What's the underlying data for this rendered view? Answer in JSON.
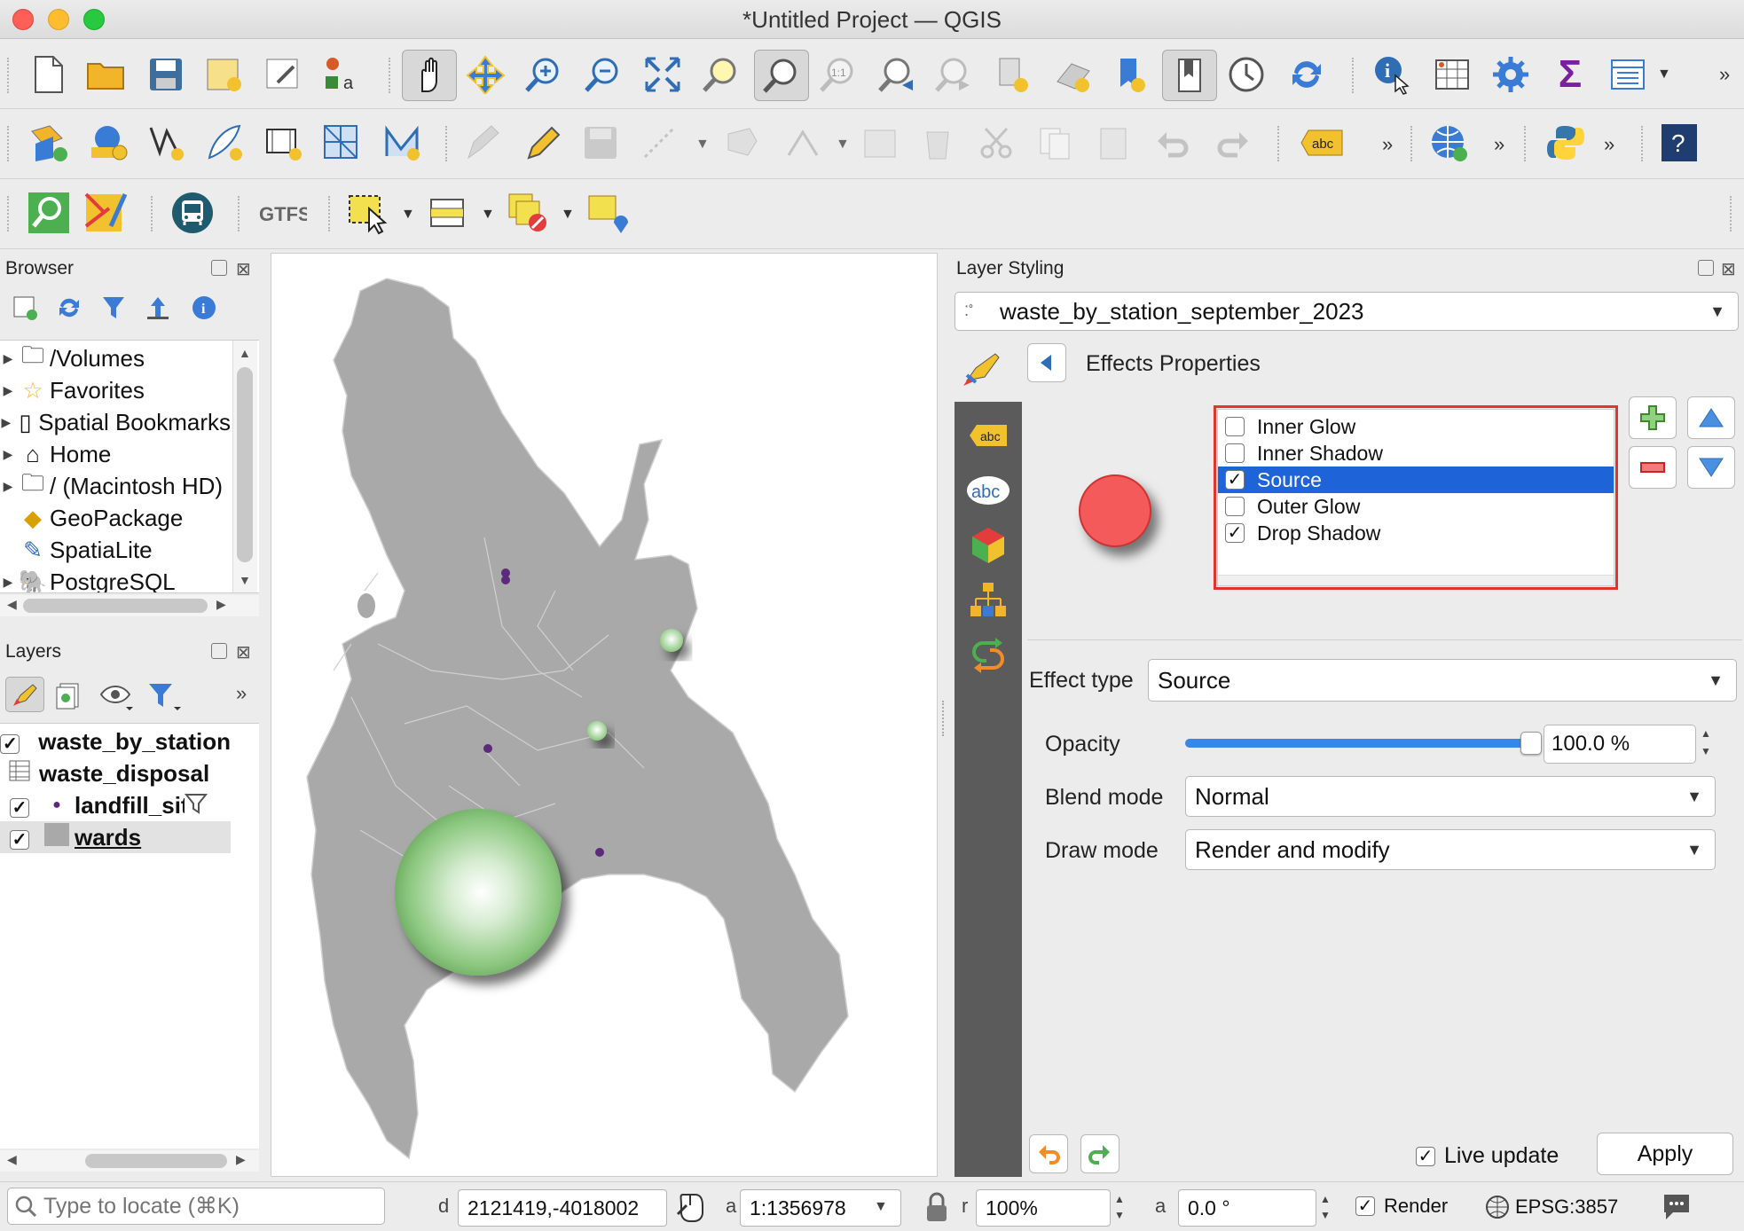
{
  "window": {
    "title": "*Untitled Project — QGIS"
  },
  "browser": {
    "title": "Browser",
    "items": [
      {
        "label": "/Volumes",
        "icon": "folder-icon"
      },
      {
        "label": "Favorites",
        "icon": "star-icon"
      },
      {
        "label": "Spatial Bookmarks",
        "icon": "bookmark-icon"
      },
      {
        "label": "Home",
        "icon": "home-icon"
      },
      {
        "label": "/ (Macintosh HD)",
        "icon": "folder-icon"
      },
      {
        "label": "GeoPackage",
        "icon": "geopackage-icon"
      },
      {
        "label": "SpatiaLite",
        "icon": "feather-icon"
      },
      {
        "label": "PostgreSQL",
        "icon": "elephant-icon"
      }
    ]
  },
  "layers": {
    "title": "Layers",
    "items": [
      {
        "label": "waste_by_station",
        "checked": true
      },
      {
        "label": "waste_disposal",
        "checked": false
      },
      {
        "label": "landfill_sites",
        "checked": true
      },
      {
        "label": "wards",
        "checked": true
      }
    ]
  },
  "styling": {
    "title": "Layer Styling",
    "layer_name": "waste_by_station_september_2023",
    "section_title": "Effects Properties",
    "effects": [
      {
        "label": "Inner Glow",
        "checked": false,
        "selected": false
      },
      {
        "label": "Inner Shadow",
        "checked": false,
        "selected": false
      },
      {
        "label": "Source",
        "checked": true,
        "selected": true
      },
      {
        "label": "Outer Glow",
        "checked": false,
        "selected": false
      },
      {
        "label": "Drop Shadow",
        "checked": true,
        "selected": false
      }
    ],
    "effect_type_label": "Effect type",
    "effect_type_value": "Source",
    "opacity_label": "Opacity",
    "opacity_value": "100.0 %",
    "opacity_fraction": 1.0,
    "blend_label": "Blend mode",
    "blend_value": "Normal",
    "draw_label": "Draw mode",
    "draw_value": "Render and modify",
    "live_update_label": "Live update",
    "live_update_checked": true,
    "apply_label": "Apply",
    "preview_color": "#f55a5a"
  },
  "statusbar": {
    "locate_placeholder": "Type to locate (⌘K)",
    "coord_label": "d",
    "coordinate": "2121419,-4018002",
    "scale_label": "a",
    "scale": "1:1356978",
    "magnifier_label": "r",
    "magnifier": "100%",
    "rotation_label": "a",
    "rotation": "0.0 °",
    "render_label": "Render",
    "crs": "EPSG:3857"
  },
  "colors": {
    "selection_blue": "#1f63d8",
    "highlight_red": "#e0352b",
    "map_gray": "#a9a9a9",
    "bubble_green": "#8bc77e"
  }
}
